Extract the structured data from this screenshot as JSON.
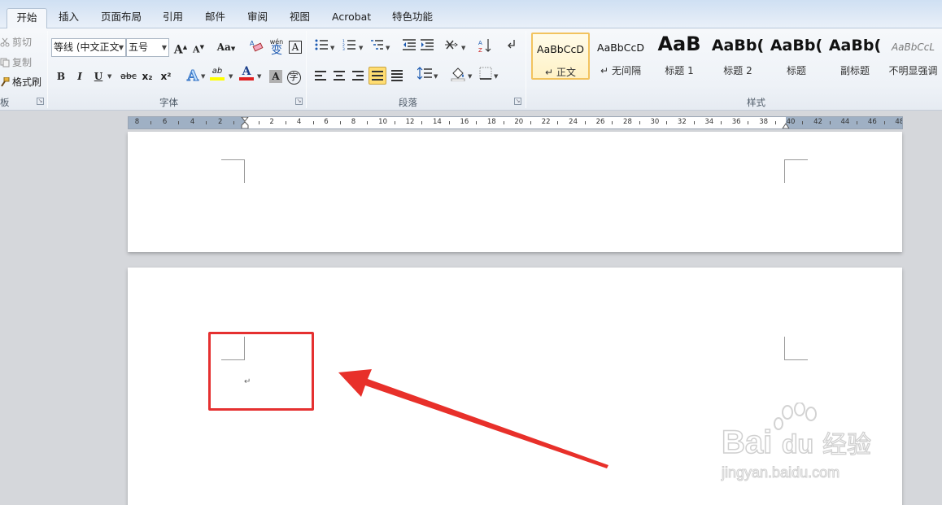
{
  "tabs": [
    "开始",
    "插入",
    "页面布局",
    "引用",
    "邮件",
    "审阅",
    "视图",
    "Acrobat",
    "特色功能"
  ],
  "active_tab": "开始",
  "clipboard": {
    "cut": "剪切",
    "copy": "复制",
    "format_painter": "格式刷",
    "group_label": "板"
  },
  "font": {
    "font_name": "等线 (中文正文",
    "font_size": "五号",
    "group_label": "字体",
    "bold": "B",
    "italic": "I",
    "underline": "U",
    "strikethrough": "abc",
    "subscript": "x₂",
    "superscript": "x²",
    "font_color_glyph": "A",
    "grow_font": "A",
    "shrink_font": "A",
    "change_case": "Aa",
    "pinyin": "wén",
    "char_char": "变",
    "char_border": "A",
    "enclose": "字",
    "highlight_glyph": "ab"
  },
  "paragraph": {
    "group_label": "段落"
  },
  "styles": {
    "group_label": "样式",
    "items": [
      {
        "sample": "AaBbCcD",
        "name": "正文",
        "mark": "↵"
      },
      {
        "sample": "AaBbCcD",
        "name": "无间隔",
        "mark": "↵"
      },
      {
        "sample": "AaB",
        "name": "标题 1",
        "mark": ""
      },
      {
        "sample": "AaBb(",
        "name": "标题 2",
        "mark": ""
      },
      {
        "sample": "AaBb(",
        "name": "标题",
        "mark": ""
      },
      {
        "sample": "AaBb(",
        "name": "副标题",
        "mark": ""
      },
      {
        "sample": "AaBbCcL",
        "name": "不明显强调",
        "mark": ""
      }
    ]
  },
  "ruler": {
    "left_labels": [
      "8",
      "6",
      "4",
      "2"
    ],
    "labels": [
      "2",
      "4",
      "6",
      "8",
      "10",
      "12",
      "14",
      "16",
      "18",
      "20",
      "22",
      "24",
      "26",
      "28",
      "30",
      "32",
      "34",
      "36",
      "38",
      "40",
      "42",
      "44",
      "46",
      "48"
    ]
  },
  "document": {
    "paragraph_mark": "↵"
  },
  "watermark": {
    "brand": "Bai",
    "brand2": "du",
    "suffix": "经验",
    "url": "jingyan.baidu.com"
  },
  "colors": {
    "highlight": "#e53030",
    "active_button": "#ffdd72",
    "font_color": "#e02020",
    "highlight_color": "#ffff00"
  }
}
